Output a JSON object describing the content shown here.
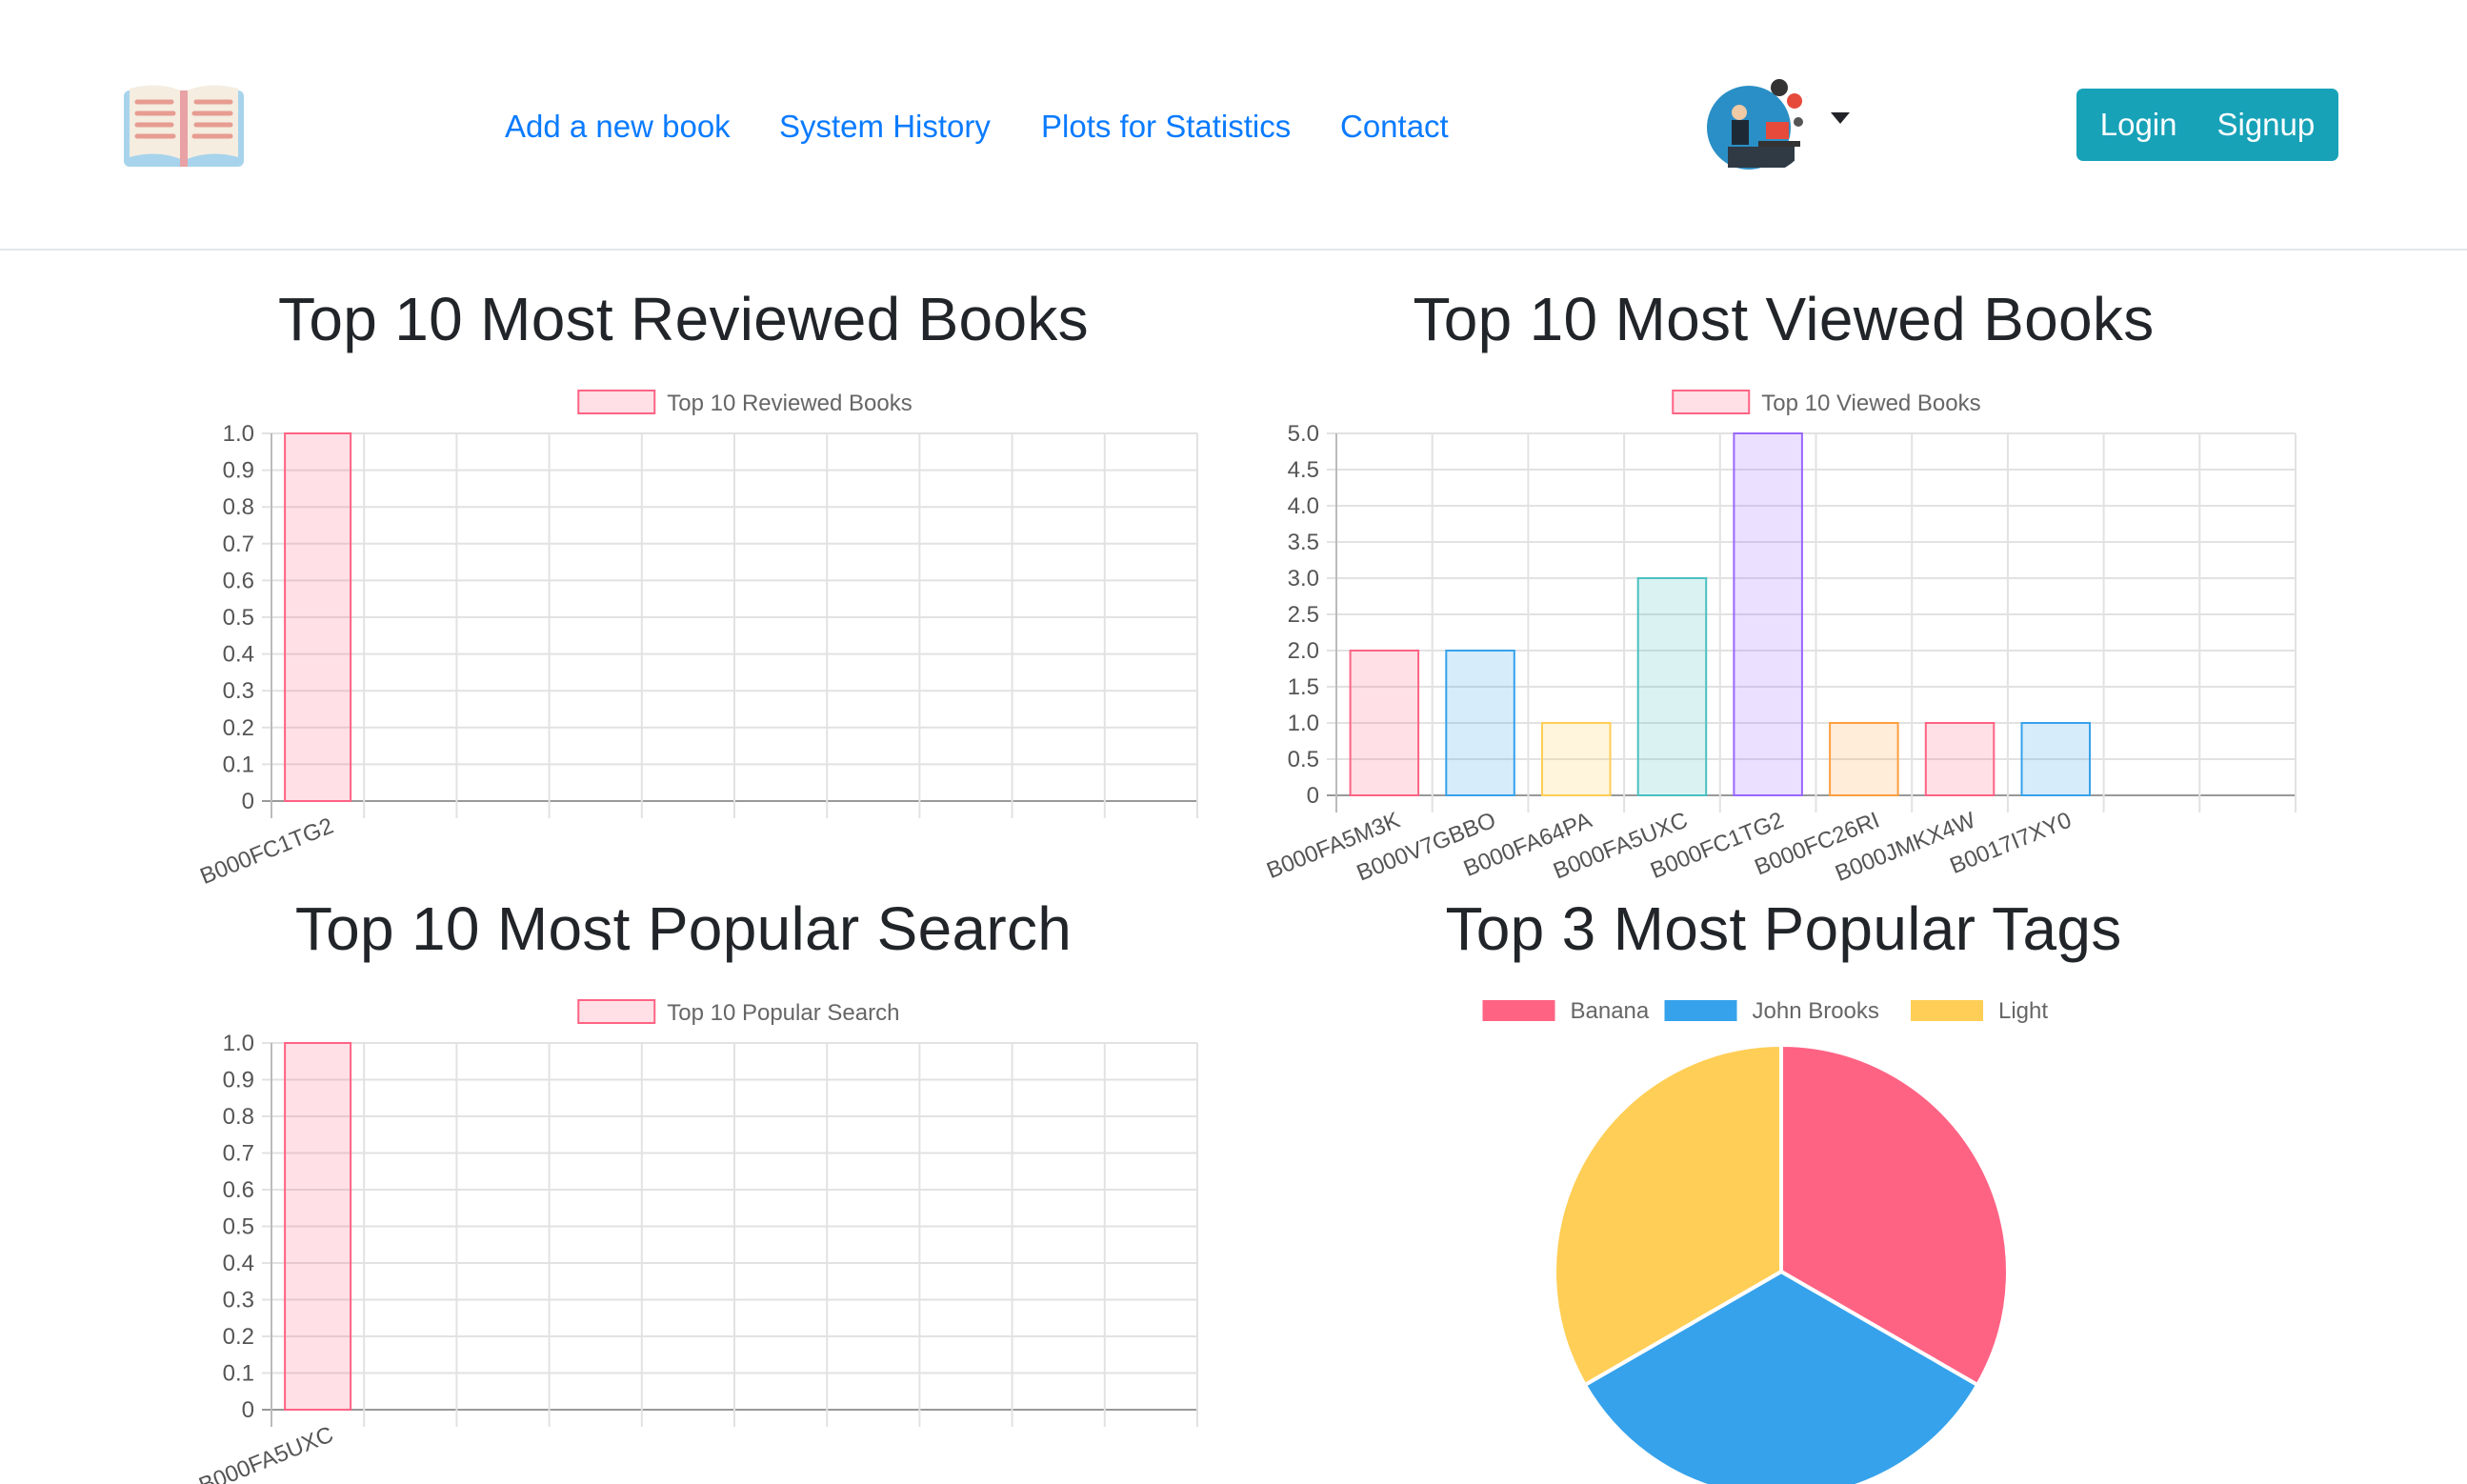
{
  "navbar": {
    "links": [
      "Add a new book",
      "System History",
      "Plots for Statistics",
      "Contact"
    ],
    "login_label": "Login",
    "signup_label": "Signup",
    "logo_icon": "open-book-icon",
    "avatar_icon": "user-avatar-illustration"
  },
  "charts": {
    "reviewed_title": "Top 10 Most Reviewed Books",
    "viewed_title": "Top 10 Most Viewed Books",
    "search_title": "Top 10 Most Popular Search",
    "tags_title": "Top 3 Most Popular Tags"
  },
  "chart_data": [
    {
      "id": "reviewed",
      "type": "bar",
      "title": "Top 10 Most Reviewed Books",
      "legend": "Top 10 Reviewed Books",
      "categories": [
        "B000FC1TG2"
      ],
      "values": [
        1
      ],
      "ylim": [
        0,
        1.0
      ],
      "yticks": [
        "1.0",
        "0.9",
        "0.8",
        "0.7",
        "0.6",
        "0.5",
        "0.4",
        "0.3",
        "0.2",
        "0.1",
        "0"
      ],
      "slots": 10,
      "grid": true,
      "colors": [
        "#ff6384"
      ]
    },
    {
      "id": "viewed",
      "type": "bar",
      "title": "Top 10 Most Viewed Books",
      "legend": "Top 10 Viewed Books",
      "categories": [
        "B000FA5M3K",
        "B000V7GBBO",
        "B000FA64PA",
        "B000FA5UXC",
        "B000FC1TG2",
        "B000FC26RI",
        "B000JMKX4W",
        "B0017I7XY0"
      ],
      "values": [
        2,
        2,
        1,
        3,
        5,
        1,
        1,
        1
      ],
      "ylim": [
        0,
        5.0
      ],
      "yticks": [
        "5.0",
        "4.5",
        "4.0",
        "3.5",
        "3.0",
        "2.5",
        "2.0",
        "1.5",
        "1.0",
        "0.5",
        "0"
      ],
      "slots": 10,
      "grid": true,
      "colors": [
        "#ff6384",
        "#36a2eb",
        "#ffce56",
        "#4bc0c0",
        "#9966ff",
        "#ff9f40",
        "#ff6384",
        "#36a2eb"
      ]
    },
    {
      "id": "search",
      "type": "bar",
      "title": "Top 10 Most Popular Search",
      "legend": "Top 10 Popular Search",
      "categories": [
        "B000FA5UXC"
      ],
      "values": [
        1
      ],
      "ylim": [
        0,
        1.0
      ],
      "yticks": [
        "1.0",
        "0.9",
        "0.8",
        "0.7",
        "0.6",
        "0.5",
        "0.4",
        "0.3",
        "0.2",
        "0.1",
        "0"
      ],
      "slots": 10,
      "grid": true,
      "colors": [
        "#ff6384"
      ]
    },
    {
      "id": "tags",
      "type": "pie",
      "title": "Top 3 Most Popular Tags",
      "categories": [
        "Banana",
        "John Brooks",
        "Light"
      ],
      "values": [
        1,
        1,
        1
      ],
      "colors": [
        "#ff6384",
        "#36a2eb",
        "#ffce56"
      ]
    }
  ]
}
